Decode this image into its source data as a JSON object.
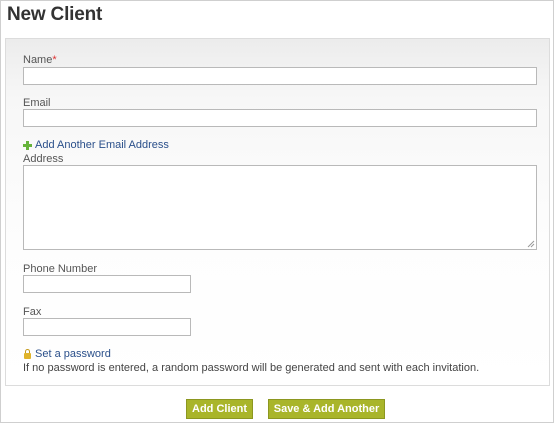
{
  "page": {
    "title": "New Client"
  },
  "form": {
    "name_label": "Name",
    "required_mark": "*",
    "email_label": "Email",
    "add_email_link": "Add Another Email Address",
    "address_label": "Address",
    "phone_label": "Phone Number",
    "fax_label": "Fax",
    "set_password_link": "Set a password",
    "password_hint": "If no password is entered, a random password will be generated and sent with each invitation.",
    "name_value": "",
    "email_value": "",
    "address_value": "",
    "phone_value": "",
    "fax_value": ""
  },
  "actions": {
    "add_client_label": "Add Client",
    "save_add_another_label": "Save & Add Another"
  },
  "icons": {
    "add_email": "plus-icon",
    "password": "lock-icon"
  },
  "colors": {
    "button_bg": "#a9b52a",
    "link": "#2a4f8a",
    "required": "#dd3333"
  }
}
